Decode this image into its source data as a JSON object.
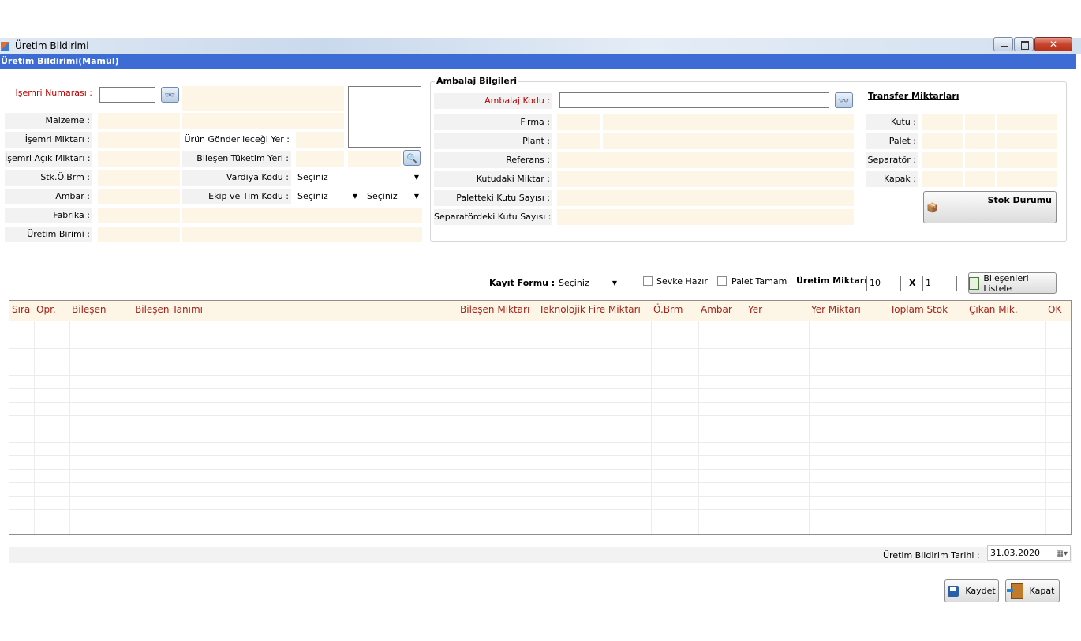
{
  "window": {
    "title": "Üretim Bildirimi",
    "subtitle": "Üretim Bildirimi(Mamül)",
    "controls": [
      "minimize",
      "maximize",
      "close"
    ]
  },
  "left_form": {
    "isemri_numarasi": "İşemri Numarası :",
    "malzeme": "Malzeme :",
    "isemri_miktari": "İşemri Miktarı :",
    "isemri_acik_miktari": "İşemri Açık Miktarı :",
    "stk_obrm": "Stk.Ö.Brm :",
    "ambar": "Ambar :",
    "fabrika": "Fabrika :",
    "uretim_birimi": "Üretim Birimi :",
    "urun_gonderilecegi_yer": "Ürün Gönderileceği Yer :",
    "bilesen_tuketim_yeri": "Bileşen Tüketim Yeri :",
    "vardiya_kodu": "Vardiya Kodu :",
    "ekip_tim_kodu": "Ekip ve Tim Kodu :",
    "vardiya_value": "Seçiniz",
    "ekip_value": "Seçiniz",
    "tim_value": "Seçiniz"
  },
  "ambalaj": {
    "group_title": "Ambalaj Bilgileri",
    "ambalaj_kodu": "Ambalaj Kodu :",
    "firma": "Firma :",
    "plant": "Plant :",
    "referans": "Referans :",
    "kutudaki_miktar": "Kutudaki Miktar :",
    "paletteki_kutu": "Paletteki Kutu Sayısı :",
    "separatordeki_kutu": "Separatördeki Kutu Sayısı :"
  },
  "transfer": {
    "title": "Transfer Miktarları",
    "kutu": "Kutu :",
    "palet": "Palet :",
    "separator": "Separatör :",
    "kapak": "Kapak :",
    "stok_durumu": "Stok Durumu"
  },
  "toolbar": {
    "kayit_formu": "Kayıt Formu :",
    "kayit_value": "Seçiniz",
    "sevke_hazir": "Sevke Hazır",
    "palet_tamam": "Palet Tamam",
    "uretim_miktari": "Üretim Miktarı :",
    "miktar1": "10",
    "x": "X",
    "miktar2": "1",
    "bilesenleri_listele": "Bileşenleri Listele"
  },
  "grid": {
    "columns": [
      "Sıra",
      "Opr.",
      "Bileşen",
      "Bileşen Tanımı",
      "Bileşen Miktarı",
      "Teknolojik Fire Miktarı",
      "Ö.Brm",
      "Ambar",
      "Yer",
      "Yer Miktarı",
      "Toplam Stok",
      "Çıkan Mik.",
      "OK"
    ]
  },
  "footer": {
    "tarih_label": "Üretim Bildirim Tarihi :",
    "tarih_value": "31.03.2020",
    "kaydet": "Kaydet",
    "kapat": "Kapat"
  },
  "colors": {
    "title_bar": "#3c6cd4",
    "readonly_bg": "#fdf5e6",
    "required_label": "#c00000",
    "grid_header_text": "#a4231a"
  }
}
